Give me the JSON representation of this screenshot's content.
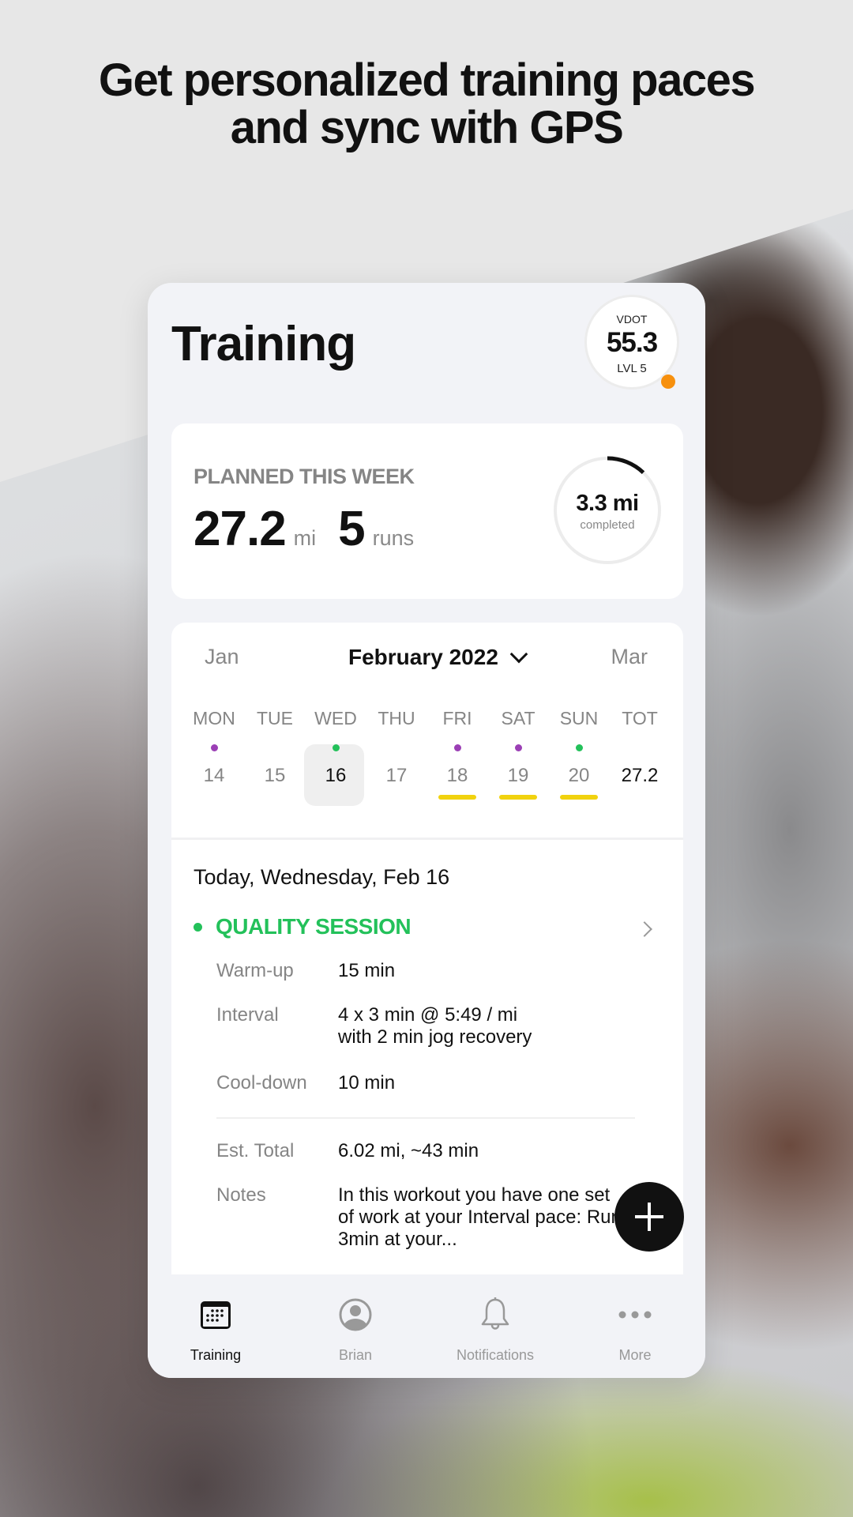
{
  "headline": {
    "line1": "Get personalized training paces",
    "line2": "and sync with GPS"
  },
  "app": {
    "title": "Training",
    "vdot": {
      "label": "VDOT",
      "value": "55.3",
      "level": "LVL 5",
      "indicator_color": "#f7900e"
    },
    "week": {
      "heading": "PLANNED THIS WEEK",
      "distance": "27.2",
      "distance_unit": "mi",
      "runs": "5",
      "runs_unit": "runs",
      "completed_value": "3.3 mi",
      "completed_label": "completed",
      "completed_fraction": 0.121
    },
    "calendar": {
      "prev_month": "Jan",
      "current_month": "February 2022",
      "next_month": "Mar",
      "days": [
        {
          "name": "MON",
          "date": "14",
          "dot": "#9b3fb5",
          "underline": false,
          "today": false
        },
        {
          "name": "TUE",
          "date": "15",
          "dot": null,
          "underline": false,
          "today": false
        },
        {
          "name": "WED",
          "date": "16",
          "dot": "#23c15a",
          "underline": false,
          "today": true
        },
        {
          "name": "THU",
          "date": "17",
          "dot": null,
          "underline": false,
          "today": false
        },
        {
          "name": "FRI",
          "date": "18",
          "dot": "#9b3fb5",
          "underline": true,
          "today": false
        },
        {
          "name": "SAT",
          "date": "19",
          "dot": "#9b3fb5",
          "underline": true,
          "today": false
        },
        {
          "name": "SUN",
          "date": "20",
          "dot": "#23c15a",
          "underline": true,
          "today": false
        },
        {
          "name": "TOT",
          "date": "27.2",
          "dot": null,
          "underline": false,
          "today": false,
          "total": true
        }
      ]
    },
    "detail": {
      "date": "Today, Wednesday, Feb 16",
      "session_type": "QUALITY SESSION",
      "session_color": "#23c15a",
      "rows": [
        {
          "key": "Warm-up",
          "value": "15 min"
        },
        {
          "key": "Interval",
          "value": "4 x 3 min @ 5:49 / mi",
          "value2": "with 2 min jog recovery"
        },
        {
          "key": "Cool-down",
          "value": "10 min"
        },
        {
          "key": "Est. Total",
          "value": "6.02 mi, ~43 min"
        },
        {
          "key": "Notes",
          "value": "In this workout you have one set of work at your Interval pace: Run 3min at your..."
        }
      ]
    },
    "fab": {
      "icon": "plus-icon"
    },
    "tabs": [
      {
        "label": "Training",
        "icon": "calendar-icon",
        "active": true
      },
      {
        "label": "Brian",
        "icon": "profile-icon",
        "active": false
      },
      {
        "label": "Notifications",
        "icon": "bell-icon",
        "active": false
      },
      {
        "label": "More",
        "icon": "more-icon",
        "active": false
      }
    ]
  }
}
